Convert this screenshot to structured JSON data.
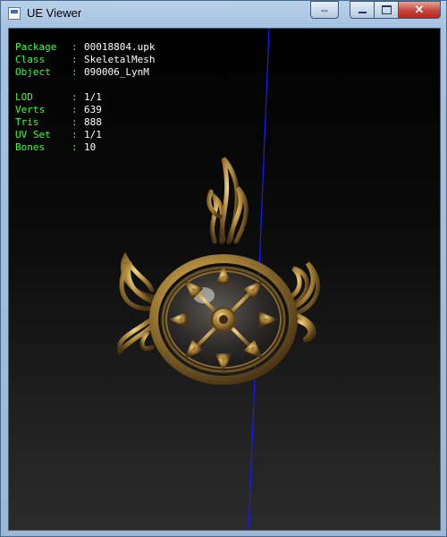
{
  "window": {
    "title": "UE Viewer",
    "icons": {
      "app": "app-icon",
      "restore": "restore-icon",
      "minimize": "minimize-icon",
      "maximize": "maximize-icon",
      "close": "close-icon"
    }
  },
  "info": {
    "group1": [
      {
        "label": "Package",
        "value": "00018804.upk"
      },
      {
        "label": "Class",
        "value": "SkeletalMesh"
      },
      {
        "label": "Object",
        "value": "090006_LynM"
      }
    ],
    "group2": [
      {
        "label": "LOD",
        "value": "1/1"
      },
      {
        "label": "Verts",
        "value": "639"
      },
      {
        "label": "Tris",
        "value": "888"
      },
      {
        "label": "UV Set",
        "value": "1/1"
      },
      {
        "label": "Bones",
        "value": "10"
      }
    ],
    "separator": ":",
    "label_color": "#33ff33",
    "value_color": "#ffffff"
  },
  "colors": {
    "axis_line": "#1a1aff",
    "mesh_gold": "#b08a3c"
  }
}
